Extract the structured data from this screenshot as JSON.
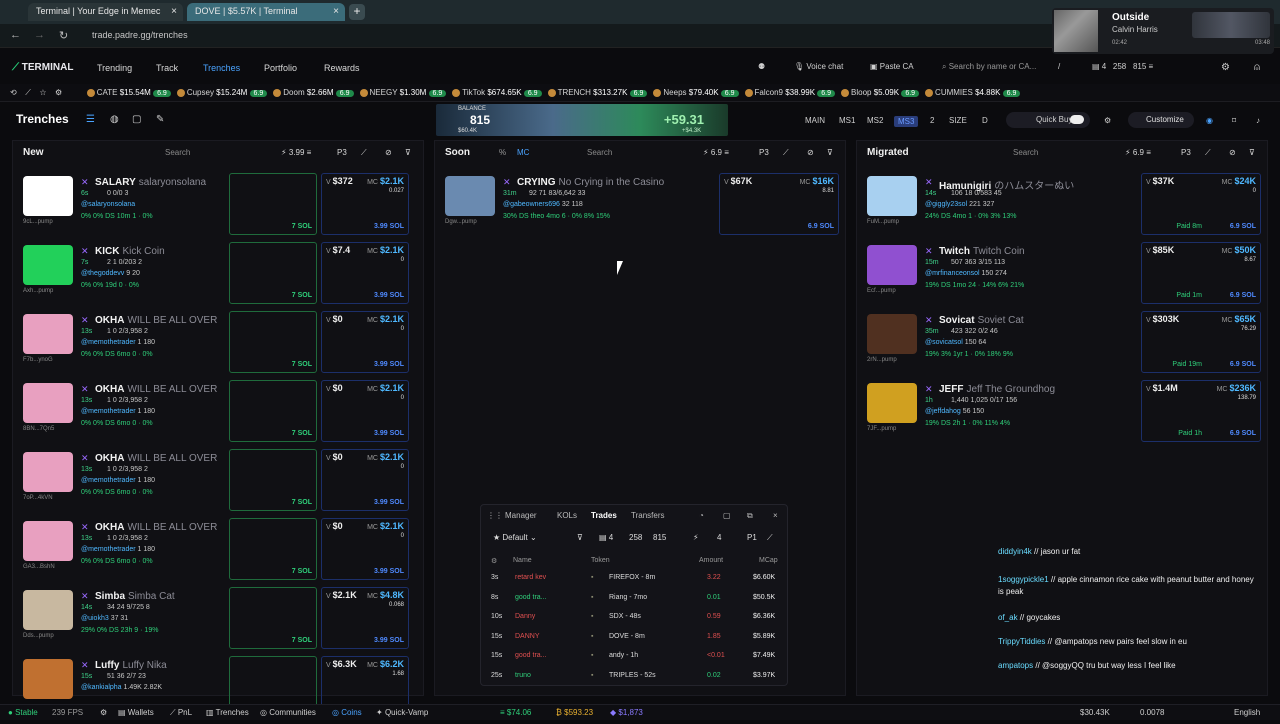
{
  "browser": {
    "tabs": [
      {
        "title": "Terminal | Your Edge in Memec"
      },
      {
        "title": "DOVE | $5.57K | Terminal"
      }
    ],
    "url": "trade.padre.gg/trenches"
  },
  "media": {
    "title": "Outside",
    "artist": "Calvin Harris",
    "elapsed": "02:42",
    "duration": "03:48"
  },
  "nav": {
    "logo": "TERMINAL",
    "links": [
      "Trending",
      "Track",
      "Trenches",
      "Portfolio",
      "Rewards"
    ],
    "voice_chat": "Voice chat",
    "paste_ca": "Paste CA",
    "search_placeholder": "Search by name or CA...",
    "slash": "/",
    "wallet_count": "4",
    "stat_a": "258",
    "stat_b": "815"
  },
  "ticker": [
    {
      "name": "CATE",
      "mc": "$15.54M",
      "pct": "6.9"
    },
    {
      "name": "Cupsey",
      "mc": "$15.24M",
      "pct": "6.9"
    },
    {
      "name": "Doom",
      "mc": "$2.66M",
      "pct": "6.9"
    },
    {
      "name": "NEEGY",
      "mc": "$1.30M",
      "pct": "6.9"
    },
    {
      "name": "TikTok",
      "mc": "$674.65K",
      "pct": "6.9"
    },
    {
      "name": "TRENCH",
      "mc": "$313.27K",
      "pct": "6.9"
    },
    {
      "name": "Neeps",
      "mc": "$79.40K",
      "pct": "6.9"
    },
    {
      "name": "Falcon9",
      "mc": "$38.99K",
      "pct": "6.9"
    },
    {
      "name": "Bloop",
      "mc": "$5.09K",
      "pct": "6.9"
    },
    {
      "name": "CUMMIES",
      "mc": "$4.88K",
      "pct": "6.9"
    }
  ],
  "toolbar": {
    "title": "Trenches",
    "balance_label": "BALANCE",
    "balance": "815",
    "balance_sub": "$60.4K",
    "gain": "+59.31",
    "gain_sub": "+$4.3K",
    "main": "MAIN",
    "ms1": "MS1",
    "ms2": "MS2",
    "ms3": "MS3",
    "two": "2",
    "size": "SIZE",
    "d": "D",
    "quick_buy": "Quick Buy",
    "customize": "Customize"
  },
  "columns": {
    "new": {
      "title": "New",
      "search": "Search",
      "amount": "3.99",
      "preset": "P3"
    },
    "soon": {
      "title": "Soon",
      "pct": "%",
      "mc": "MC",
      "search": "Search",
      "amount": "6.9",
      "preset": "P3"
    },
    "migrated": {
      "title": "Migrated",
      "search": "Search",
      "amount": "6.9",
      "preset": "P3"
    }
  },
  "new_cards": [
    {
      "ticker": "SALARY",
      "name": "salaryonsolana",
      "age": "6s",
      "handle": "@salaryonsolana",
      "addr": "9cL...pump",
      "row": "0  0/0  3",
      "holders": "",
      "stats": "0%  0%  DS  10m  1 · 0%",
      "v": "$372",
      "mc": "$2.1K",
      "f": "0.027",
      "sol": "7 SOL",
      "bsol": "3.99 SOL",
      "avatar": "#ffffff"
    },
    {
      "ticker": "KICK",
      "name": "Kick Coin",
      "age": "7s",
      "handle": "@thegoddevv",
      "addr": "Axh...pump",
      "row": "2  1  0/203  2",
      "holders": "9  20",
      "stats": "0%  0%  19d  0 · 0%",
      "v": "$7.4",
      "mc": "$2.1K",
      "f": "0",
      "sol": "7 SOL",
      "bsol": "3.99 SOL",
      "avatar": "#22d05a"
    },
    {
      "ticker": "OKHA",
      "name": "WILL BE ALL OVER",
      "age": "13s",
      "handle": "@memothetrader",
      "addr": "F7b...ynoG",
      "row": "1  0  2/3,958  2",
      "holders": "1  180",
      "stats": "0%  0%  DS  6mo  0 · 0%",
      "v": "$0",
      "mc": "$2.1K",
      "f": "0",
      "sol": "7 SOL",
      "bsol": "3.99 SOL",
      "avatar": "#e8a0c0"
    },
    {
      "ticker": "OKHA",
      "name": "WILL BE ALL OVER",
      "age": "13s",
      "handle": "@memothetrader",
      "addr": "8BN...7Qn5",
      "row": "1  0  2/3,958  2",
      "holders": "1  180",
      "stats": "0%  0%  DS  6mo  0 · 0%",
      "v": "$0",
      "mc": "$2.1K",
      "f": "0",
      "sol": "7 SOL",
      "bsol": "3.99 SOL",
      "avatar": "#e8a0c0"
    },
    {
      "ticker": "OKHA",
      "name": "WILL BE ALL OVER",
      "age": "13s",
      "handle": "@memothetrader",
      "addr": "7oP...4kVN",
      "row": "1  0  2/3,958  2",
      "holders": "1  180",
      "stats": "0%  0%  DS  6mo  0 · 0%",
      "v": "$0",
      "mc": "$2.1K",
      "f": "0",
      "sol": "7 SOL",
      "bsol": "3.99 SOL",
      "avatar": "#e8a0c0"
    },
    {
      "ticker": "OKHA",
      "name": "WILL BE ALL OVER",
      "age": "13s",
      "handle": "@memothetrader",
      "addr": "GA3...BshN",
      "row": "1  0  2/3,958  2",
      "holders": "1  180",
      "stats": "0%  0%  DS  6mo  0 · 0%",
      "v": "$0",
      "mc": "$2.1K",
      "f": "0",
      "sol": "7 SOL",
      "bsol": "3.99 SOL",
      "avatar": "#e8a0c0"
    },
    {
      "ticker": "Simba",
      "name": "Simba Cat",
      "age": "14s",
      "handle": "@uiokh3",
      "addr": "Dds...pump",
      "row": "34  24  9/725  8",
      "holders": "37  31",
      "stats": "29%  0%  DS  23h  9 · 19%",
      "v": "$2.1K",
      "mc": "$4.8K",
      "f": "0.068",
      "sol": "7 SOL",
      "bsol": "3.99 SOL",
      "avatar": "#c8b8a0"
    },
    {
      "ticker": "Luffy",
      "name": "Luffy Nika",
      "age": "15s",
      "handle": "@kankialpha",
      "addr": "",
      "row": "51  36  2/7  23",
      "holders": "1.49K  2.82K",
      "stats": "",
      "v": "$6.3K",
      "mc": "$6.2K",
      "f": "1.68",
      "sol": "",
      "bsol": "",
      "avatar": "#c07030"
    }
  ],
  "soon_cards": [
    {
      "ticker": "CRYING",
      "name": "No Crying in the Casino",
      "age": "31m",
      "handle": "@gabeowners696",
      "addr": "Dgw...pump",
      "row": "92  71  83/6,642  33",
      "holders": "32  118",
      "stats": "30%  DS  theo  4mo  6 · 0%  8%  15%",
      "v": "$67K",
      "mc": "$16K",
      "f": "8.81",
      "bsol": "6.9 SOL",
      "avatar": "#6a8ab0"
    }
  ],
  "migrated_cards": [
    {
      "ticker": "Hamunigiri",
      "name": "のハムスターぬい",
      "age": "14s",
      "handle": "@giggly23sol",
      "addr": "FuM...pump",
      "row": "106  18  0/583  45",
      "holders": "221  327",
      "stats": "24%  DS  4mo  1 · 0%  3%  13%",
      "v": "$37K",
      "mc": "$24K",
      "f": "0",
      "paid": "Paid 8m",
      "bsol": "6.9 SOL",
      "avatar": "#a8d0f0",
      "tag": "Hamster plushie"
    },
    {
      "ticker": "Twitch",
      "name": "Twitch Coin",
      "age": "15m",
      "handle": "@mrfinanceonsol",
      "addr": "Ecf...pump",
      "row": "507  363  3/15  113",
      "holders": "150  274",
      "stats": "19%  DS  1mo  24 · 14%  6%  21%",
      "v": "$85K",
      "mc": "$50K",
      "f": "8.67",
      "paid": "Paid 1m",
      "bsol": "6.9 SOL",
      "avatar": "#9050d0",
      "tag": "LIVE"
    },
    {
      "ticker": "Sovicat",
      "name": "Soviet Cat",
      "age": "35m",
      "handle": "@sovicatsol",
      "addr": "2rN...pump",
      "row": "423  322  0/2  46",
      "holders": "150  64",
      "stats": "19%  3%  1yr  1 · 0%  18%  9%",
      "v": "$303K",
      "mc": "$65K",
      "f": "76.29",
      "paid": "Paid 19m",
      "bsol": "6.9 SOL",
      "avatar": "#503020",
      "tag": ""
    },
    {
      "ticker": "JEFF",
      "name": "Jeff The Groundhog",
      "age": "1h",
      "handle": "@jeffdahog",
      "addr": "7JF...pump",
      "row": "1,440  1,025  0/17  156",
      "holders": "56  150",
      "stats": "19%  DS  2h  1 · 0%  11%  4%",
      "v": "$1.4M",
      "mc": "$236K",
      "f": "138.79",
      "paid": "Paid 1h",
      "bsol": "6.9 SOL",
      "avatar": "#d0a020",
      "tag": ""
    }
  ],
  "trades": {
    "tabs": [
      "Manager",
      "KOLs",
      "Trades",
      "Transfers"
    ],
    "filter": "Default",
    "count": "4",
    "a": "258",
    "b": "815",
    "p": "P1",
    "headers": [
      "Name",
      "Token",
      "Amount",
      "MCap"
    ],
    "rows": [
      {
        "age": "3s",
        "name": "retard kev",
        "token": "FIREFOX - 8m",
        "amount": "3.22",
        "mcap": "$6.60K",
        "side": "sell"
      },
      {
        "age": "8s",
        "name": "good tra...",
        "token": "Riang - 7mo",
        "amount": "0.01",
        "mcap": "$50.5K",
        "side": "buy"
      },
      {
        "age": "10s",
        "name": "Danny",
        "token": "SDX - 48s",
        "amount": "0.59",
        "mcap": "$6.36K",
        "side": "sell"
      },
      {
        "age": "15s",
        "name": "DANNY",
        "token": "DOVE - 8m",
        "amount": "1.85",
        "mcap": "$5.89K",
        "side": "sell"
      },
      {
        "age": "15s",
        "name": "good tra...",
        "token": "andy - 1h",
        "amount": "<0.01",
        "mcap": "$7.49K",
        "side": "sell"
      },
      {
        "age": "25s",
        "name": "truno",
        "token": "TRIPLES - 52s",
        "amount": "0.02",
        "mcap": "$3.97K",
        "side": "buy"
      }
    ]
  },
  "chat": [
    {
      "user": "diddyin4k",
      "text": "jason ur fat"
    },
    {
      "user": "1soggypickle1",
      "text": "apple cinnamon rice cake with peanut butter and honey is peak"
    },
    {
      "user": "of_ak",
      "text": "goycakes"
    },
    {
      "user": "TrippyTiddies",
      "text": "@ampatops new pairs feel slow in eu"
    },
    {
      "user": "ampatops",
      "text": "@soggyQQ tru but way less I feel like"
    }
  ],
  "status": {
    "stable": "Stable",
    "fps": "239 FPS",
    "wallets": "Wallets",
    "pnl": "PnL",
    "trenches": "Trenches",
    "communities": "Communities",
    "coins": "Coins",
    "quick_vamp": "Quick-Vamp",
    "sol_price": "$74.06",
    "btc_price": "$593.23",
    "eth_price": "$1,873",
    "right_a": "$30.43K",
    "right_b": "0.0078",
    "lang": "English"
  },
  "colors": {
    "accent": "#4aa3ff",
    "green": "#2fcf7a",
    "red": "#e05050",
    "bg": "#0b0b0e"
  }
}
